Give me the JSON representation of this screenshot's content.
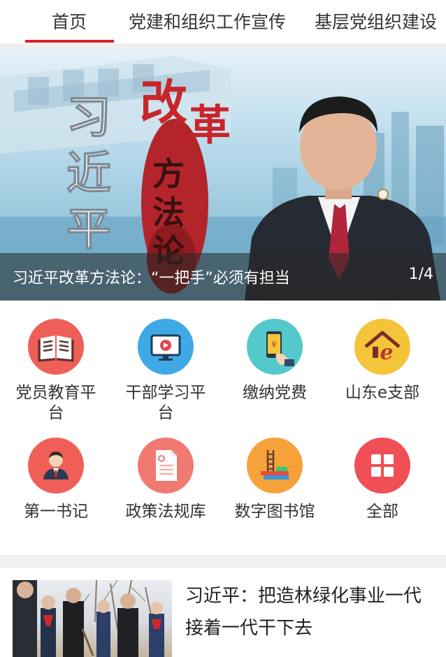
{
  "tabs": [
    {
      "label": "首页",
      "active": true
    },
    {
      "label": "党建和组织工作宣传",
      "active": false
    },
    {
      "label": "基层党组织建设",
      "active": false
    }
  ],
  "accent_color": "#d9222a",
  "banner": {
    "caption": "习近平改革方法论：“一把手”必须有担当",
    "page_indicator": "1/4",
    "art_text": {
      "vertical_name": [
        "习",
        "近",
        "平"
      ],
      "title_red": [
        "改",
        "革"
      ],
      "title_dark": [
        "方",
        "法",
        "论"
      ]
    }
  },
  "grid": [
    {
      "label": "党员教育平台",
      "icon": "book-icon",
      "color": "#ef5f58"
    },
    {
      "label": "干部学习平台",
      "icon": "monitor-play-icon",
      "color": "#3fa9e6"
    },
    {
      "label": "缴纳党费",
      "icon": "phone-payment-icon",
      "color": "#54c9cc"
    },
    {
      "label": "山东e支部",
      "icon": "e-branch-house-icon",
      "color": "#f4c43a"
    },
    {
      "label": "第一书记",
      "icon": "person-icon",
      "color": "#ef5f58"
    },
    {
      "label": "政策法规库",
      "icon": "document-icon",
      "color": "#f07a72"
    },
    {
      "label": "数字图书馆",
      "icon": "bookshelf-icon",
      "color": "#f6a13a"
    },
    {
      "label": "全部",
      "icon": "grid-icon",
      "color": "#ef4f55"
    }
  ],
  "news": [
    {
      "title": "习近平：把造林绿化事业一代接着一代干下去"
    }
  ]
}
